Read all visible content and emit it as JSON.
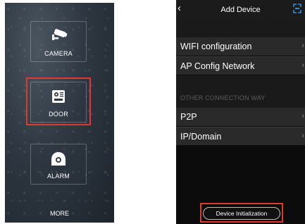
{
  "left_screen": {
    "tiles": {
      "camera": {
        "label": "CAMERA",
        "icon": "security-camera-icon"
      },
      "door": {
        "label": "DOOR",
        "icon": "door-intercom-icon"
      },
      "alarm": {
        "label": "ALARM",
        "icon": "alarm-icon"
      }
    },
    "more_label": "MORE",
    "highlight_color": "#e0392f"
  },
  "right_screen": {
    "header": {
      "title": "Add Device",
      "back_icon": "back-chevron-icon",
      "scan_icon": "scan-icon"
    },
    "items": [
      {
        "label": "WIFI configuration"
      },
      {
        "label": "AP Config Network"
      }
    ],
    "section_label": "OTHER CONNECTION WAY",
    "other_items": [
      {
        "label": "P2P"
      },
      {
        "label": "IP/Domain"
      }
    ],
    "init_button": "Device Initialization",
    "accent_color": "#2f8fd6",
    "highlight_color": "#e0392f"
  }
}
